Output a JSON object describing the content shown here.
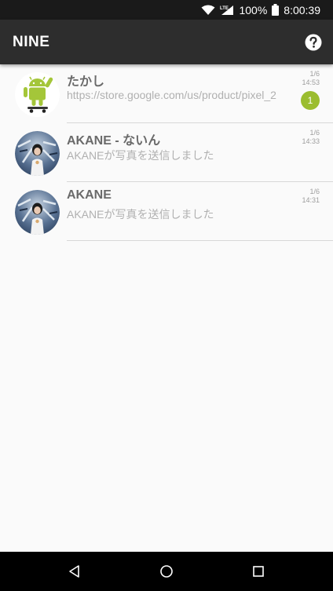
{
  "status_bar": {
    "battery": "100%",
    "time": "8:00:39",
    "network": "LTE",
    "icons": [
      "wifi-icon",
      "signal-icon",
      "battery-icon"
    ]
  },
  "app_bar": {
    "title": "NINE",
    "help_icon": "help-icon"
  },
  "chats": [
    {
      "name": "たかし",
      "preview": "https://store.google.com/us/product/pixel_2",
      "date": "1/6",
      "time": "14:53",
      "unread": "1",
      "avatar": "android-robot"
    },
    {
      "name": "AKANE - ないん",
      "preview": "AKANEが写真を送信しました",
      "date": "1/6",
      "time": "14:33",
      "unread": "",
      "avatar": "photo-woman-umbrella"
    },
    {
      "name": "AKANE",
      "preview": "AKANEが写真を送信しました",
      "date": "1/6",
      "time": "14:31",
      "unread": "",
      "avatar": "photo-woman-umbrella"
    }
  ],
  "nav_bar": {
    "icons": [
      "back-icon",
      "home-icon",
      "recents-icon"
    ]
  },
  "colors": {
    "app_bar": "#2d2d2d",
    "status_bar": "#1a1a1a",
    "badge": "#9bbd2f",
    "background": "#fafafa"
  }
}
